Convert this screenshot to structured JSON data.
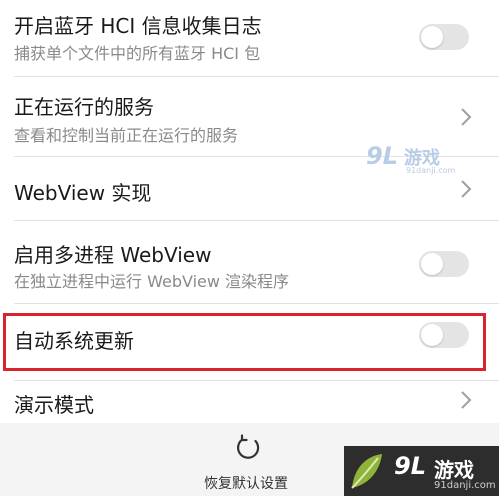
{
  "settings": {
    "items": [
      {
        "title": "开启蓝牙 HCI 信息收集日志",
        "subtitle": "捕获单个文件中的所有蓝牙 HCI 包",
        "control": "toggle",
        "enabled": false
      },
      {
        "title": "正在运行的服务",
        "subtitle": "查看和控制当前正在运行的服务",
        "control": "chevron"
      },
      {
        "title": "WebView 实现",
        "control": "chevron"
      },
      {
        "title": "启用多进程 WebView",
        "subtitle": "在独立进程中运行 WebView 渲染程序",
        "control": "toggle",
        "enabled": false
      },
      {
        "title": "自动系统更新",
        "control": "toggle",
        "enabled": false,
        "highlighted": true
      },
      {
        "title": "演示模式",
        "control": "chevron"
      }
    ]
  },
  "bottom_bar": {
    "reset_label": "恢复默认设置",
    "reset_icon": "refresh-icon"
  },
  "watermarks": {
    "middle": {
      "mark": "9L",
      "text": "游戏",
      "url": "91danji.com"
    },
    "corner": {
      "mark": "9L",
      "text": "游戏",
      "url": "91danji.com"
    }
  },
  "colors": {
    "highlight_border": "#d9232d",
    "toggle_off": "#e4e4e4",
    "subtitle_text": "#8a8a8a",
    "bottom_bar": "#f4f4f4"
  }
}
